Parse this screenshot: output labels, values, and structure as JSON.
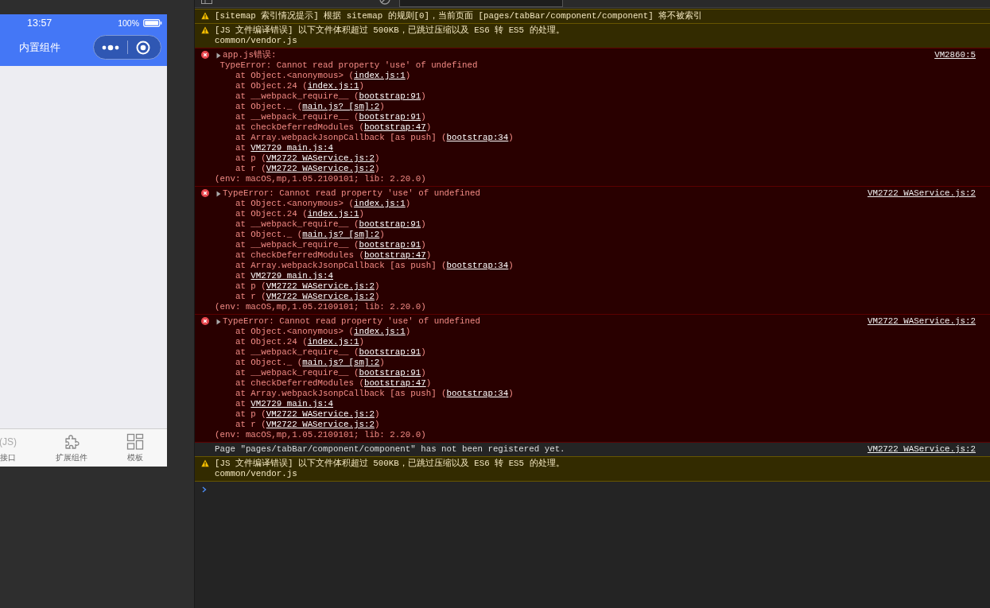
{
  "simulator": {
    "status_bar": {
      "time": "13:57",
      "battery": "100%"
    },
    "nav_title": "内置组件",
    "tab_bar": [
      {
        "kind": "text",
        "icon_text": "(JS)",
        "label": "接口"
      },
      {
        "kind": "puzzle",
        "label": "扩展组件"
      },
      {
        "kind": "grid",
        "label": "模板"
      }
    ]
  },
  "console": {
    "messages": [
      {
        "kind": "warning",
        "lines": [
          [
            "[sitemap 索引情况提示] 根据 sitemap 的规则[0]，当前页面 [pages/tabBar/component/component] 将不被索引"
          ]
        ]
      },
      {
        "kind": "warning",
        "lines": [
          [
            "[JS 文件编译错误] 以下文件体积超过 500KB，已跳过压缩以及 ES6 转 ES5 的处理。"
          ],
          [
            "common/vendor.js"
          ]
        ]
      },
      {
        "kind": "error",
        "collapsible": true,
        "source": "VM2860:5",
        "lines": [
          [
            "app.js错误:"
          ],
          [
            " TypeError: Cannot read property 'use' of undefined"
          ],
          [
            "    at Object.<anonymous> (",
            {
              "t": "index.js:1",
              "link": true
            },
            ")"
          ],
          [
            "    at Object.24 (",
            {
              "t": "index.js:1",
              "link": true
            },
            ")"
          ],
          [
            "    at __webpack_require__ (",
            {
              "t": "bootstrap:91",
              "link": true
            },
            ")"
          ],
          [
            "    at Object._ (",
            {
              "t": "main.js? [sm]:2",
              "link": true
            },
            ")"
          ],
          [
            "    at __webpack_require__ (",
            {
              "t": "bootstrap:91",
              "link": true
            },
            ")"
          ],
          [
            "    at checkDeferredModules (",
            {
              "t": "bootstrap:47",
              "link": true
            },
            ")"
          ],
          [
            "    at Array.webpackJsonpCallback [as push] (",
            {
              "t": "bootstrap:34",
              "link": true
            },
            ")"
          ],
          [
            "    at ",
            {
              "t": "VM2729 main.js:4",
              "link": true
            }
          ],
          [
            "    at p (",
            {
              "t": "VM2722 WAService.js:2",
              "link": true
            },
            ")"
          ],
          [
            "    at r (",
            {
              "t": "VM2722 WAService.js:2",
              "link": true
            },
            ")"
          ],
          [
            "(env: macOS,mp,1.05.2109101; lib: 2.20.0)"
          ]
        ]
      },
      {
        "kind": "error",
        "collapsible": true,
        "source": "VM2722 WAService.js:2",
        "lines": [
          [
            "TypeError: Cannot read property 'use' of undefined"
          ],
          [
            "    at Object.<anonymous> (",
            {
              "t": "index.js:1",
              "link": true
            },
            ")"
          ],
          [
            "    at Object.24 (",
            {
              "t": "index.js:1",
              "link": true
            },
            ")"
          ],
          [
            "    at __webpack_require__ (",
            {
              "t": "bootstrap:91",
              "link": true
            },
            ")"
          ],
          [
            "    at Object._ (",
            {
              "t": "main.js? [sm]:2",
              "link": true
            },
            ")"
          ],
          [
            "    at __webpack_require__ (",
            {
              "t": "bootstrap:91",
              "link": true
            },
            ")"
          ],
          [
            "    at checkDeferredModules (",
            {
              "t": "bootstrap:47",
              "link": true
            },
            ")"
          ],
          [
            "    at Array.webpackJsonpCallback [as push] (",
            {
              "t": "bootstrap:34",
              "link": true
            },
            ")"
          ],
          [
            "    at ",
            {
              "t": "VM2729 main.js:4",
              "link": true
            }
          ],
          [
            "    at p (",
            {
              "t": "VM2722 WAService.js:2",
              "link": true
            },
            ")"
          ],
          [
            "    at r (",
            {
              "t": "VM2722 WAService.js:2",
              "link": true
            },
            ")"
          ],
          [
            "(env: macOS,mp,1.05.2109101; lib: 2.20.0)"
          ]
        ]
      },
      {
        "kind": "error",
        "collapsible": true,
        "source": "VM2722 WAService.js:2",
        "lines": [
          [
            "TypeError: Cannot read property 'use' of undefined"
          ],
          [
            "    at Object.<anonymous> (",
            {
              "t": "index.js:1",
              "link": true
            },
            ")"
          ],
          [
            "    at Object.24 (",
            {
              "t": "index.js:1",
              "link": true
            },
            ")"
          ],
          [
            "    at __webpack_require__ (",
            {
              "t": "bootstrap:91",
              "link": true
            },
            ")"
          ],
          [
            "    at Object._ (",
            {
              "t": "main.js? [sm]:2",
              "link": true
            },
            ")"
          ],
          [
            "    at __webpack_require__ (",
            {
              "t": "bootstrap:91",
              "link": true
            },
            ")"
          ],
          [
            "    at checkDeferredModules (",
            {
              "t": "bootstrap:47",
              "link": true
            },
            ")"
          ],
          [
            "    at Array.webpackJsonpCallback [as push] (",
            {
              "t": "bootstrap:34",
              "link": true
            },
            ")"
          ],
          [
            "    at ",
            {
              "t": "VM2729 main.js:4",
              "link": true
            }
          ],
          [
            "    at p (",
            {
              "t": "VM2722 WAService.js:2",
              "link": true
            },
            ")"
          ],
          [
            "    at r (",
            {
              "t": "VM2722 WAService.js:2",
              "link": true
            },
            ")"
          ],
          [
            "(env: macOS,mp,1.05.2109101; lib: 2.20.0)"
          ]
        ]
      },
      {
        "kind": "info",
        "source": "VM2722 WAService.js:2",
        "lines": [
          [
            "Page \"pages/tabBar/component/component\" has not been registered yet."
          ]
        ]
      },
      {
        "kind": "warning",
        "lines": [
          [
            "[JS 文件编译错误] 以下文件体积超过 500KB，已跳过压缩以及 ES6 转 ES5 的处理。"
          ],
          [
            "common/vendor.js"
          ]
        ]
      }
    ]
  }
}
